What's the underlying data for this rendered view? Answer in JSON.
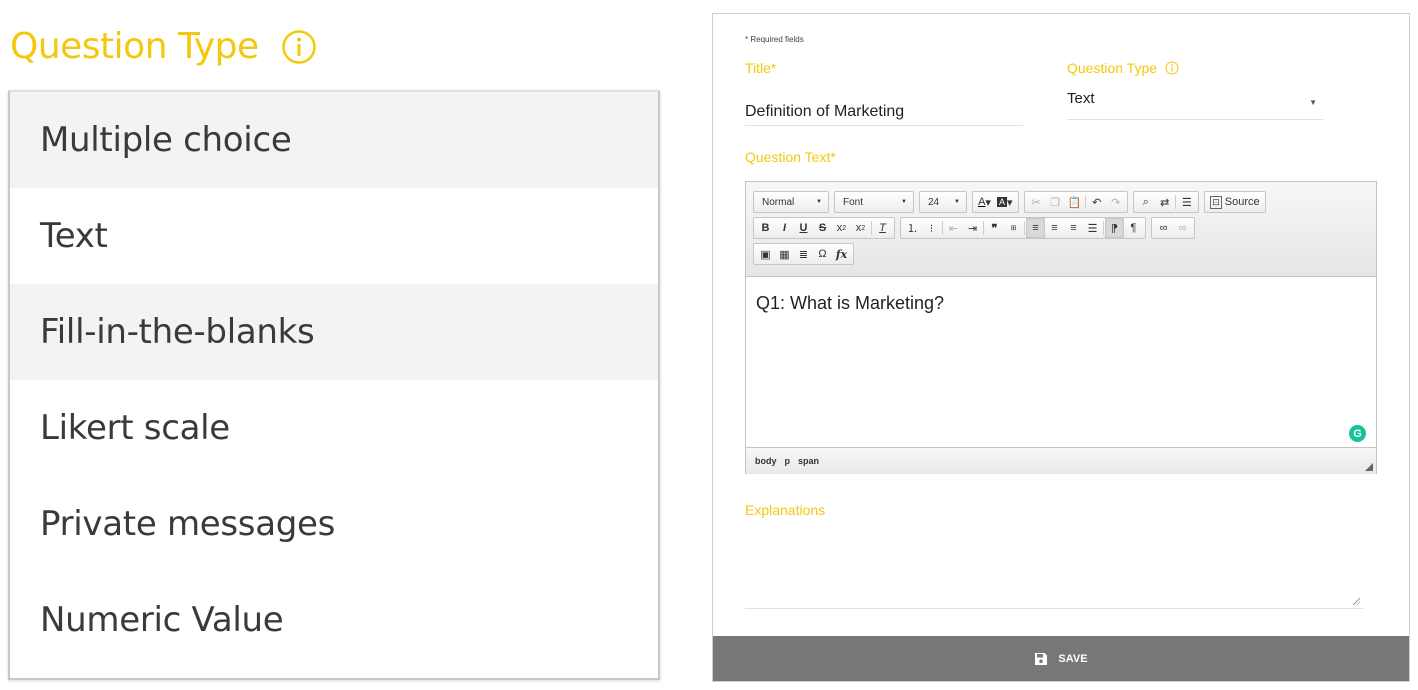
{
  "left_panel": {
    "label": "Question Type",
    "options": [
      "Multiple choice",
      "Text",
      "Fill-in-the-blanks",
      "Likert scale",
      "Private messages",
      "Numeric Value"
    ]
  },
  "form": {
    "required_note": "* Required fields",
    "title_label": "Title*",
    "title_value": "Definition of Marketing",
    "question_type_label": "Question Type",
    "question_type_value": "Text",
    "question_text_label": "Question Text*",
    "editor": {
      "format_combo": "Normal",
      "font_combo": "Font",
      "size_combo": "24",
      "source_label": "Source",
      "content": "Q1: What is Marketing?",
      "path": [
        "body",
        "p",
        "span"
      ]
    },
    "explanations_label": "Explanations",
    "save_label": "SAVE"
  },
  "colors": {
    "accent": "#f4c80f",
    "save_bar": "#777777",
    "grammarly": "#15c39a"
  }
}
